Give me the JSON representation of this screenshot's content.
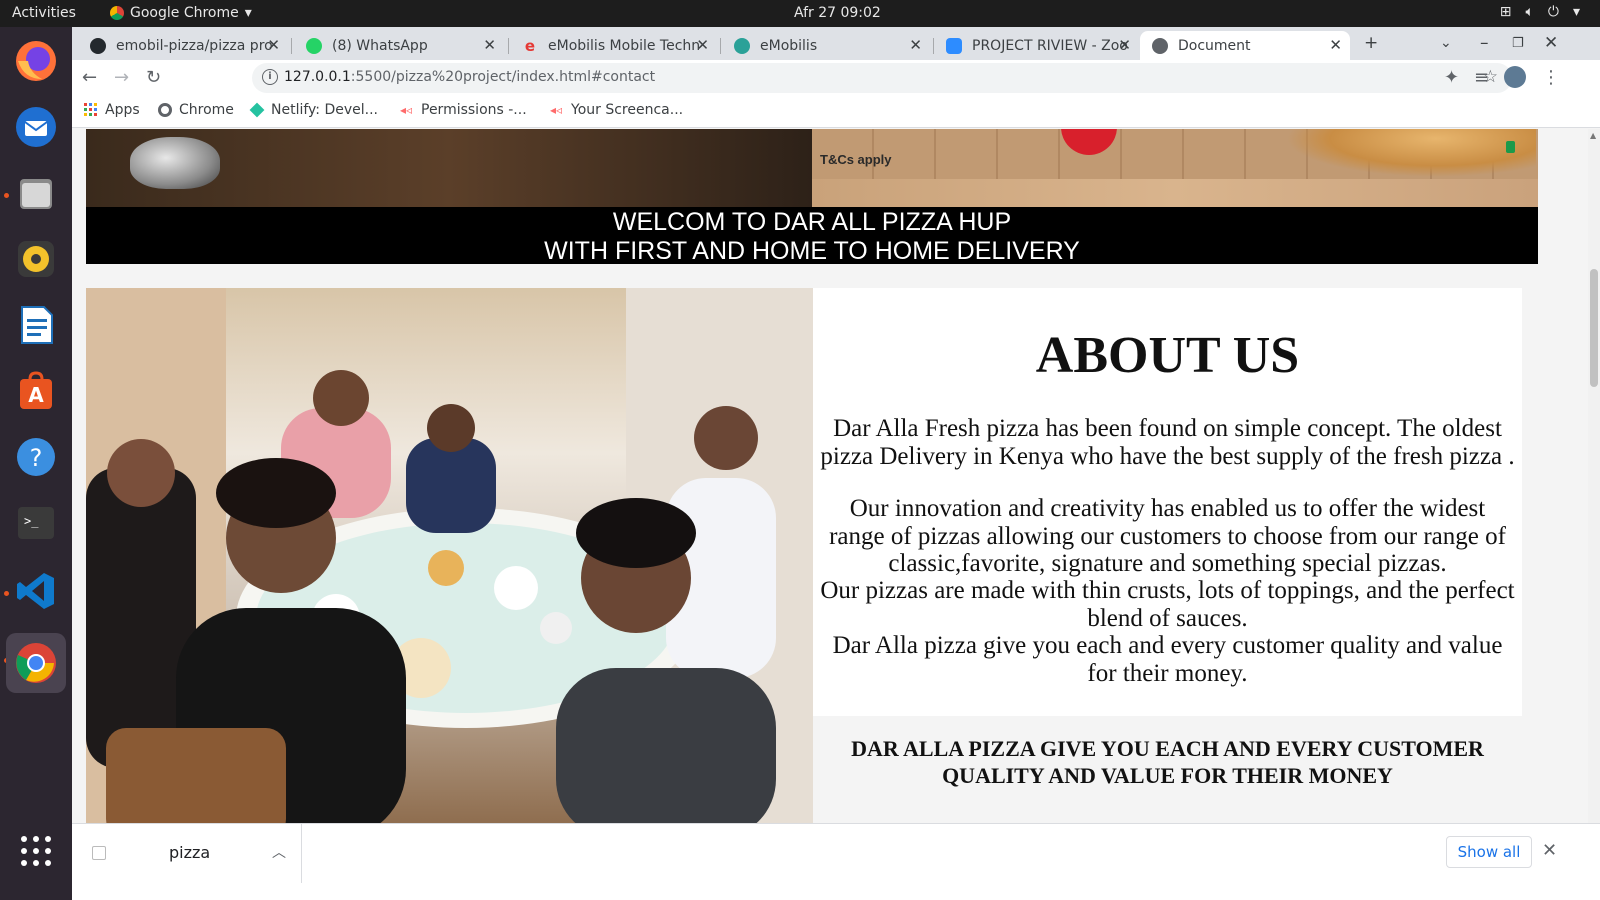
{
  "system": {
    "activities": "Activities",
    "app_name": "Google Chrome",
    "clock": "Afr 27  09:02"
  },
  "tabs": [
    {
      "title": "emobil-pizza/pizza pro",
      "icon": "github-icon"
    },
    {
      "title": "(8) WhatsApp",
      "icon": "whatsapp-icon"
    },
    {
      "title": "eMobilis Mobile Techn",
      "icon": "emobilis-icon"
    },
    {
      "title": "eMobilis",
      "icon": "globe-icon"
    },
    {
      "title": "PROJECT RIVIEW - Zoo",
      "icon": "zoom-icon"
    },
    {
      "title": "Document",
      "icon": "globe-icon"
    }
  ],
  "address_bar": {
    "url_host": "127.0.0.1",
    "url_path": ":5500/pizza%20project/index.html#contact"
  },
  "bookmarks": [
    {
      "label": "Apps",
      "icon": "apps-grid-icon"
    },
    {
      "label": "Chrome",
      "icon": "chrome-icon"
    },
    {
      "label": "Netlify: Devel...",
      "icon": "netlify-icon"
    },
    {
      "label": "Permissions -...",
      "icon": "screencastify-icon"
    },
    {
      "label": "Your Screenca...",
      "icon": "screencastify-icon"
    }
  ],
  "page": {
    "hero_tc": "T&Cs apply",
    "welcome_line1": "WELCOM TO DAR ALL PIZZA HUP",
    "welcome_line2": "WITH FIRST AND HOME TO HOME DELIVERY",
    "about_title": "ABOUT US",
    "about_p1": "Dar Alla Fresh pizza has been found on simple concept. The oldest pizza Delivery in Kenya who have the best supply of the fresh pizza .",
    "about_p2": "Our innovation and creativity has enabled us to offer the widest range of pizzas allowing our customers to choose from our range of classic,favorite, signature and something special pizzas.",
    "about_p3": "Our pizzas are made with thin crusts, lots of toppings, and the perfect blend of sauces.",
    "about_p4": "Dar Alla pizza give you each and every customer quality and value for their money.",
    "tagline": "DAR ALLA PIZZA GIVE YOU EACH AND EVERY CUSTOMER QUALITY AND VALUE FOR THEIR MONEY"
  },
  "downloads": {
    "file_name": "pizza",
    "show_all": "Show all"
  },
  "colors": {
    "dock_bg": "#2c2630",
    "topbar_bg": "#1d1d1d",
    "tabstrip_bg": "#dee1e6",
    "link_blue": "#1a73e8",
    "ubuntu_orange": "#e95420"
  }
}
